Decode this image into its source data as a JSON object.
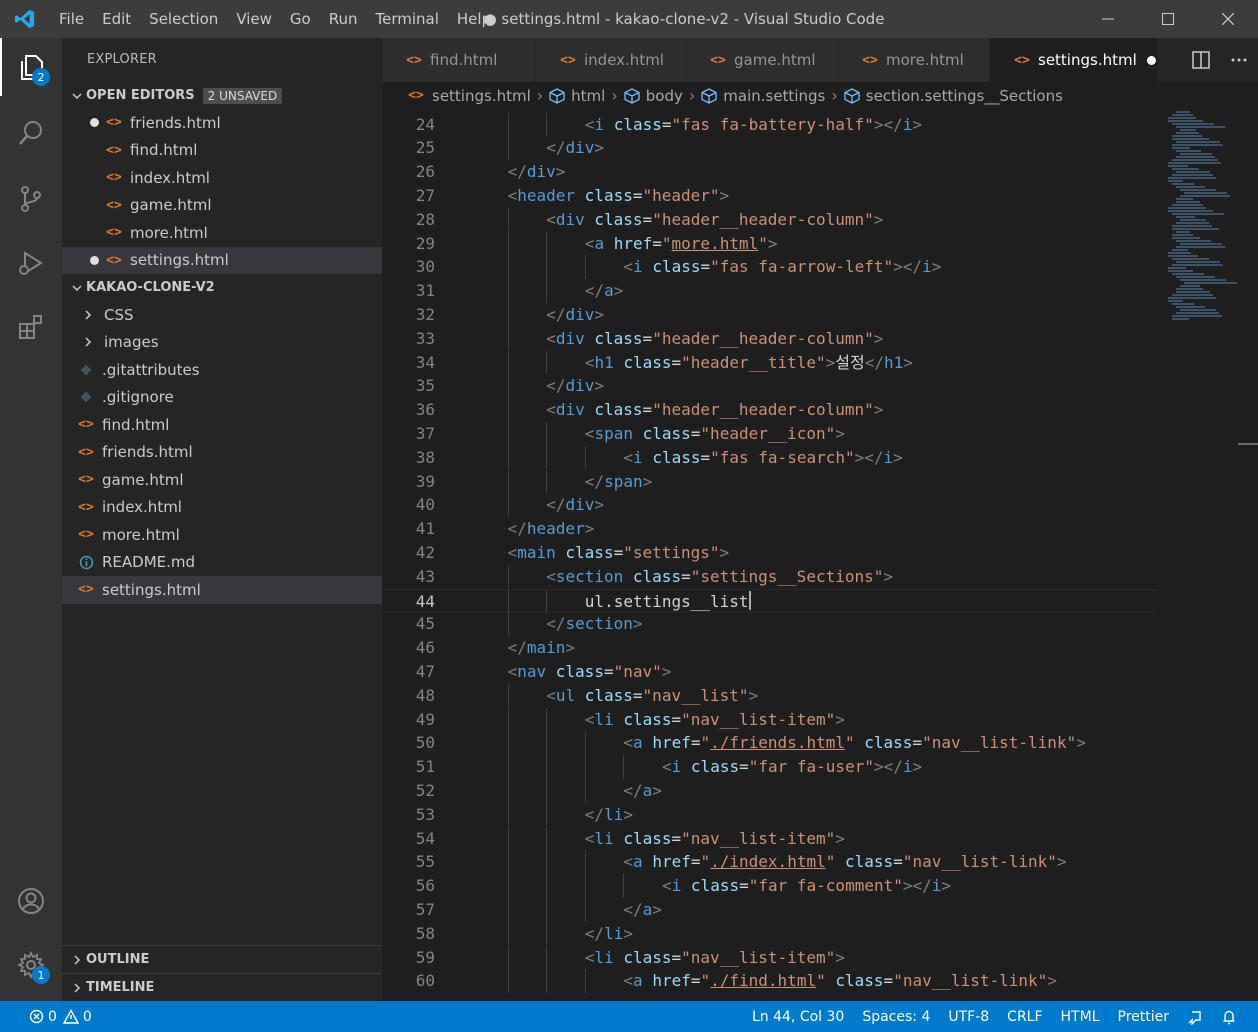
{
  "menu": [
    "File",
    "Edit",
    "Selection",
    "View",
    "Go",
    "Run",
    "Terminal",
    "Help"
  ],
  "window_title": "● settings.html - kakao-clone-v2 - Visual Studio Code",
  "activity": {
    "explorer_badge": "2",
    "settings_badge": "1"
  },
  "sidebar": {
    "title": "EXPLORER",
    "open_editors_label": "OPEN EDITORS",
    "unsaved_badge": "2 UNSAVED",
    "open_editors": [
      {
        "name": "friends.html",
        "modified": true
      },
      {
        "name": "find.html",
        "modified": false
      },
      {
        "name": "index.html",
        "modified": false
      },
      {
        "name": "game.html",
        "modified": false
      },
      {
        "name": "more.html",
        "modified": false
      },
      {
        "name": "settings.html",
        "modified": true
      }
    ],
    "project_label": "KAKAO-CLONE-V2",
    "folders": [
      "CSS",
      "images"
    ],
    "files": [
      {
        "name": ".gitattributes",
        "icon": "git-icon"
      },
      {
        "name": ".gitignore",
        "icon": "git-icon"
      },
      {
        "name": "find.html",
        "icon": "html-icon"
      },
      {
        "name": "friends.html",
        "icon": "html-icon"
      },
      {
        "name": "game.html",
        "icon": "html-icon"
      },
      {
        "name": "index.html",
        "icon": "html-icon"
      },
      {
        "name": "more.html",
        "icon": "html-icon"
      },
      {
        "name": "README.md",
        "icon": "info-icon"
      },
      {
        "name": "settings.html",
        "icon": "html-icon"
      }
    ],
    "outline_label": "OUTLINE",
    "timeline_label": "TIMELINE"
  },
  "tabs": [
    {
      "label": "find.html",
      "active": false
    },
    {
      "label": "index.html",
      "active": false
    },
    {
      "label": "game.html",
      "active": false
    },
    {
      "label": "more.html",
      "active": false
    },
    {
      "label": "settings.html",
      "active": true
    }
  ],
  "breadcrumb": [
    "settings.html",
    "html",
    "body",
    "main.settings",
    "section.settings__Sections"
  ],
  "code": [
    {
      "n": "24",
      "indent": 3,
      "parts": [
        [
          "p",
          "<"
        ],
        [
          "t",
          "i"
        ],
        [
          "d",
          " "
        ],
        [
          "a",
          "class"
        ],
        [
          "d",
          "="
        ],
        [
          "s",
          "\"fas fa-battery-half\""
        ],
        [
          "p",
          ">"
        ],
        [
          "p",
          "</"
        ],
        [
          "t",
          "i"
        ],
        [
          "p",
          ">"
        ]
      ]
    },
    {
      "n": "25",
      "indent": 2,
      "parts": [
        [
          "p",
          "</"
        ],
        [
          "t",
          "div"
        ],
        [
          "p",
          ">"
        ]
      ]
    },
    {
      "n": "26",
      "indent": 1,
      "parts": [
        [
          "p",
          "</"
        ],
        [
          "t",
          "div"
        ],
        [
          "p",
          ">"
        ]
      ]
    },
    {
      "n": "27",
      "indent": 1,
      "parts": [
        [
          "p",
          "<"
        ],
        [
          "t",
          "header"
        ],
        [
          "d",
          " "
        ],
        [
          "a",
          "class"
        ],
        [
          "d",
          "="
        ],
        [
          "s",
          "\"header\""
        ],
        [
          "p",
          ">"
        ]
      ]
    },
    {
      "n": "28",
      "indent": 2,
      "parts": [
        [
          "p",
          "<"
        ],
        [
          "t",
          "div"
        ],
        [
          "d",
          " "
        ],
        [
          "a",
          "class"
        ],
        [
          "d",
          "="
        ],
        [
          "s",
          "\"header__header-column\""
        ],
        [
          "p",
          ">"
        ]
      ]
    },
    {
      "n": "29",
      "indent": 3,
      "parts": [
        [
          "p",
          "<"
        ],
        [
          "t",
          "a"
        ],
        [
          "d",
          " "
        ],
        [
          "a",
          "href"
        ],
        [
          "d",
          "="
        ],
        [
          "s",
          "\""
        ],
        [
          "su",
          "more.html"
        ],
        [
          "s",
          "\""
        ],
        [
          "p",
          ">"
        ]
      ]
    },
    {
      "n": "30",
      "indent": 4,
      "parts": [
        [
          "p",
          "<"
        ],
        [
          "t",
          "i"
        ],
        [
          "d",
          " "
        ],
        [
          "a",
          "class"
        ],
        [
          "d",
          "="
        ],
        [
          "s",
          "\"fas fa-arrow-left\""
        ],
        [
          "p",
          ">"
        ],
        [
          "p",
          "</"
        ],
        [
          "t",
          "i"
        ],
        [
          "p",
          ">"
        ]
      ]
    },
    {
      "n": "31",
      "indent": 3,
      "parts": [
        [
          "p",
          "</"
        ],
        [
          "t",
          "a"
        ],
        [
          "p",
          ">"
        ]
      ]
    },
    {
      "n": "32",
      "indent": 2,
      "parts": [
        [
          "p",
          "</"
        ],
        [
          "t",
          "div"
        ],
        [
          "p",
          ">"
        ]
      ]
    },
    {
      "n": "33",
      "indent": 2,
      "parts": [
        [
          "p",
          "<"
        ],
        [
          "t",
          "div"
        ],
        [
          "d",
          " "
        ],
        [
          "a",
          "class"
        ],
        [
          "d",
          "="
        ],
        [
          "s",
          "\"header__header-column\""
        ],
        [
          "p",
          ">"
        ]
      ]
    },
    {
      "n": "34",
      "indent": 3,
      "parts": [
        [
          "p",
          "<"
        ],
        [
          "t",
          "h1"
        ],
        [
          "d",
          " "
        ],
        [
          "a",
          "class"
        ],
        [
          "d",
          "="
        ],
        [
          "s",
          "\"header__title\""
        ],
        [
          "p",
          ">"
        ],
        [
          "d",
          "설정"
        ],
        [
          "p",
          "</"
        ],
        [
          "t",
          "h1"
        ],
        [
          "p",
          ">"
        ]
      ]
    },
    {
      "n": "35",
      "indent": 2,
      "parts": [
        [
          "p",
          "</"
        ],
        [
          "t",
          "div"
        ],
        [
          "p",
          ">"
        ]
      ]
    },
    {
      "n": "36",
      "indent": 2,
      "parts": [
        [
          "p",
          "<"
        ],
        [
          "t",
          "div"
        ],
        [
          "d",
          " "
        ],
        [
          "a",
          "class"
        ],
        [
          "d",
          "="
        ],
        [
          "s",
          "\"header__header-column\""
        ],
        [
          "p",
          ">"
        ]
      ]
    },
    {
      "n": "37",
      "indent": 3,
      "parts": [
        [
          "p",
          "<"
        ],
        [
          "t",
          "span"
        ],
        [
          "d",
          " "
        ],
        [
          "a",
          "class"
        ],
        [
          "d",
          "="
        ],
        [
          "s",
          "\"header__icon\""
        ],
        [
          "p",
          ">"
        ]
      ]
    },
    {
      "n": "38",
      "indent": 4,
      "parts": [
        [
          "p",
          "<"
        ],
        [
          "t",
          "i"
        ],
        [
          "d",
          " "
        ],
        [
          "a",
          "class"
        ],
        [
          "d",
          "="
        ],
        [
          "s",
          "\"fas fa-search\""
        ],
        [
          "p",
          ">"
        ],
        [
          "p",
          "</"
        ],
        [
          "t",
          "i"
        ],
        [
          "p",
          ">"
        ]
      ]
    },
    {
      "n": "39",
      "indent": 3,
      "parts": [
        [
          "p",
          "</"
        ],
        [
          "t",
          "span"
        ],
        [
          "p",
          ">"
        ]
      ]
    },
    {
      "n": "40",
      "indent": 2,
      "parts": [
        [
          "p",
          "</"
        ],
        [
          "t",
          "div"
        ],
        [
          "p",
          ">"
        ]
      ]
    },
    {
      "n": "41",
      "indent": 1,
      "parts": [
        [
          "p",
          "</"
        ],
        [
          "t",
          "header"
        ],
        [
          "p",
          ">"
        ]
      ]
    },
    {
      "n": "42",
      "indent": 1,
      "parts": [
        [
          "p",
          "<"
        ],
        [
          "t",
          "main"
        ],
        [
          "d",
          " "
        ],
        [
          "a",
          "class"
        ],
        [
          "d",
          "="
        ],
        [
          "s",
          "\"settings\""
        ],
        [
          "p",
          ">"
        ]
      ]
    },
    {
      "n": "43",
      "indent": 2,
      "parts": [
        [
          "p",
          "<"
        ],
        [
          "t",
          "section"
        ],
        [
          "d",
          " "
        ],
        [
          "a",
          "class"
        ],
        [
          "d",
          "="
        ],
        [
          "s",
          "\"settings__Sections\""
        ],
        [
          "p",
          ">"
        ]
      ]
    },
    {
      "n": "44",
      "indent": 3,
      "current": true,
      "parts": [
        [
          "d",
          "ul.settings__list"
        ],
        [
          "c",
          ""
        ]
      ]
    },
    {
      "n": "45",
      "indent": 2,
      "parts": [
        [
          "p",
          "</"
        ],
        [
          "t",
          "section"
        ],
        [
          "p",
          ">"
        ]
      ]
    },
    {
      "n": "46",
      "indent": 1,
      "parts": [
        [
          "p",
          "</"
        ],
        [
          "t",
          "main"
        ],
        [
          "p",
          ">"
        ]
      ]
    },
    {
      "n": "47",
      "indent": 1,
      "parts": [
        [
          "p",
          "<"
        ],
        [
          "t",
          "nav"
        ],
        [
          "d",
          " "
        ],
        [
          "a",
          "class"
        ],
        [
          "d",
          "="
        ],
        [
          "s",
          "\"nav\""
        ],
        [
          "p",
          ">"
        ]
      ]
    },
    {
      "n": "48",
      "indent": 2,
      "parts": [
        [
          "p",
          "<"
        ],
        [
          "t",
          "ul"
        ],
        [
          "d",
          " "
        ],
        [
          "a",
          "class"
        ],
        [
          "d",
          "="
        ],
        [
          "s",
          "\"nav__list\""
        ],
        [
          "p",
          ">"
        ]
      ]
    },
    {
      "n": "49",
      "indent": 3,
      "parts": [
        [
          "p",
          "<"
        ],
        [
          "t",
          "li"
        ],
        [
          "d",
          " "
        ],
        [
          "a",
          "class"
        ],
        [
          "d",
          "="
        ],
        [
          "s",
          "\"nav__list-item\""
        ],
        [
          "p",
          ">"
        ]
      ]
    },
    {
      "n": "50",
      "indent": 4,
      "parts": [
        [
          "p",
          "<"
        ],
        [
          "t",
          "a"
        ],
        [
          "d",
          " "
        ],
        [
          "a",
          "href"
        ],
        [
          "d",
          "="
        ],
        [
          "s",
          "\""
        ],
        [
          "su",
          "./friends.html"
        ],
        [
          "s",
          "\""
        ],
        [
          "d",
          " "
        ],
        [
          "a",
          "class"
        ],
        [
          "d",
          "="
        ],
        [
          "s",
          "\"nav__list-link\""
        ],
        [
          "p",
          ">"
        ]
      ]
    },
    {
      "n": "51",
      "indent": 5,
      "parts": [
        [
          "p",
          "<"
        ],
        [
          "t",
          "i"
        ],
        [
          "d",
          " "
        ],
        [
          "a",
          "class"
        ],
        [
          "d",
          "="
        ],
        [
          "s",
          "\"far fa-user\""
        ],
        [
          "p",
          ">"
        ],
        [
          "p",
          "</"
        ],
        [
          "t",
          "i"
        ],
        [
          "p",
          ">"
        ]
      ]
    },
    {
      "n": "52",
      "indent": 4,
      "parts": [
        [
          "p",
          "</"
        ],
        [
          "t",
          "a"
        ],
        [
          "p",
          ">"
        ]
      ]
    },
    {
      "n": "53",
      "indent": 3,
      "parts": [
        [
          "p",
          "</"
        ],
        [
          "t",
          "li"
        ],
        [
          "p",
          ">"
        ]
      ]
    },
    {
      "n": "54",
      "indent": 3,
      "parts": [
        [
          "p",
          "<"
        ],
        [
          "t",
          "li"
        ],
        [
          "d",
          " "
        ],
        [
          "a",
          "class"
        ],
        [
          "d",
          "="
        ],
        [
          "s",
          "\"nav__list-item\""
        ],
        [
          "p",
          ">"
        ]
      ]
    },
    {
      "n": "55",
      "indent": 4,
      "parts": [
        [
          "p",
          "<"
        ],
        [
          "t",
          "a"
        ],
        [
          "d",
          " "
        ],
        [
          "a",
          "href"
        ],
        [
          "d",
          "="
        ],
        [
          "s",
          "\""
        ],
        [
          "su",
          "./index.html"
        ],
        [
          "s",
          "\""
        ],
        [
          "d",
          " "
        ],
        [
          "a",
          "class"
        ],
        [
          "d",
          "="
        ],
        [
          "s",
          "\"nav__list-link\""
        ],
        [
          "p",
          ">"
        ]
      ]
    },
    {
      "n": "56",
      "indent": 5,
      "parts": [
        [
          "p",
          "<"
        ],
        [
          "t",
          "i"
        ],
        [
          "d",
          " "
        ],
        [
          "a",
          "class"
        ],
        [
          "d",
          "="
        ],
        [
          "s",
          "\"far fa-comment\""
        ],
        [
          "p",
          ">"
        ],
        [
          "p",
          "</"
        ],
        [
          "t",
          "i"
        ],
        [
          "p",
          ">"
        ]
      ]
    },
    {
      "n": "57",
      "indent": 4,
      "parts": [
        [
          "p",
          "</"
        ],
        [
          "t",
          "a"
        ],
        [
          "p",
          ">"
        ]
      ]
    },
    {
      "n": "58",
      "indent": 3,
      "parts": [
        [
          "p",
          "</"
        ],
        [
          "t",
          "li"
        ],
        [
          "p",
          ">"
        ]
      ]
    },
    {
      "n": "59",
      "indent": 3,
      "parts": [
        [
          "p",
          "<"
        ],
        [
          "t",
          "li"
        ],
        [
          "d",
          " "
        ],
        [
          "a",
          "class"
        ],
        [
          "d",
          "="
        ],
        [
          "s",
          "\"nav__list-item\""
        ],
        [
          "p",
          ">"
        ]
      ]
    },
    {
      "n": "60",
      "indent": 4,
      "parts": [
        [
          "p",
          "<"
        ],
        [
          "t",
          "a"
        ],
        [
          "d",
          " "
        ],
        [
          "a",
          "href"
        ],
        [
          "d",
          "="
        ],
        [
          "s",
          "\""
        ],
        [
          "su",
          "./find.html"
        ],
        [
          "s",
          "\""
        ],
        [
          "d",
          " "
        ],
        [
          "a",
          "class"
        ],
        [
          "d",
          "="
        ],
        [
          "s",
          "\"nav__list-link\""
        ],
        [
          "p",
          ">"
        ]
      ]
    }
  ],
  "status": {
    "errors": "0",
    "warnings": "0",
    "position": "Ln 44, Col 30",
    "spaces": "Spaces: 4",
    "encoding": "UTF-8",
    "eol": "CRLF",
    "language": "HTML",
    "formatter": "Prettier"
  },
  "colors": {
    "accent": "#007acc",
    "tag": "#569cd6",
    "attribute": "#9cdcfe",
    "string": "#ce9178",
    "html_icon": "#e37933"
  }
}
